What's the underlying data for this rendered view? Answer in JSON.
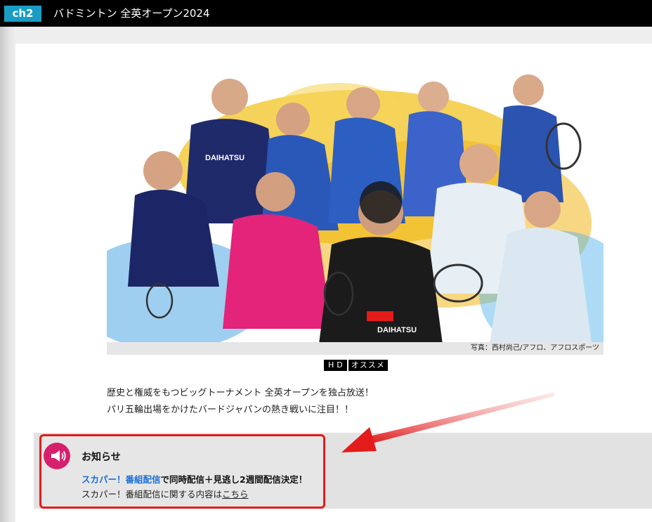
{
  "header": {
    "channel_badge": "ch2",
    "program_title": "バドミントン 全英オープン2024"
  },
  "hero": {
    "photo_credit": "写真：西村尚己/アフロ、アフロスポーツ",
    "jersey_text": "DAIHATSU"
  },
  "badges": {
    "hd": "HD",
    "recommend": "オススメ"
  },
  "description": {
    "line1": "歴史と権威をもつビッグトーナメント 全英オープンを独占放送！",
    "line2": "パリ五輪出場をかけたバードジャパンの熱き戦いに注目！！"
  },
  "notice": {
    "heading": "お知らせ",
    "link_text": "スカパー！番組配信",
    "bold_rest": "で同時配信＋見逃し2週間配信決定！",
    "line2_prefix": "スカパー！番組配信に関する内容は",
    "line2_link": "こちら"
  },
  "colors": {
    "channel_badge": "#1a9dc4",
    "link_blue": "#1a6fd6",
    "highlight_red": "#e31b1b",
    "notice_icon": "#d6206d"
  },
  "icons": {
    "notice": "megaphone-icon"
  }
}
